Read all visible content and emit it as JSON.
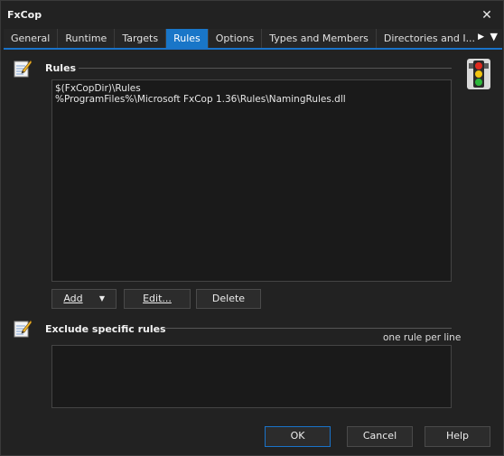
{
  "window": {
    "title": "FxCop",
    "close_glyph": "✕"
  },
  "tabs": [
    {
      "label": "General"
    },
    {
      "label": "Runtime"
    },
    {
      "label": "Targets"
    },
    {
      "label": "Rules",
      "active": true
    },
    {
      "label": "Options"
    },
    {
      "label": "Types and Members"
    },
    {
      "label": "Directories and I..."
    }
  ],
  "tabbar": {
    "scroll_glyph": "▶",
    "menu_glyph": "▼"
  },
  "rules": {
    "heading": "Rules",
    "lines": [
      "$(FxCopDir)\\Rules",
      "%ProgramFiles%\\Microsoft FxCop 1.36\\Rules\\NamingRules.dll"
    ],
    "add_label": "Add",
    "add_caret": "▼",
    "edit_label": "Edit...",
    "delete_label": "Delete"
  },
  "exclude": {
    "heading": "Exclude specific rules",
    "hint": "one rule per line",
    "value": ""
  },
  "footer": {
    "ok_label": "OK",
    "cancel_label": "Cancel",
    "help_label": "Help"
  },
  "colors": {
    "accent": "#1976c8",
    "background": "#222222",
    "textarea_bg": "#1a1a1a"
  }
}
